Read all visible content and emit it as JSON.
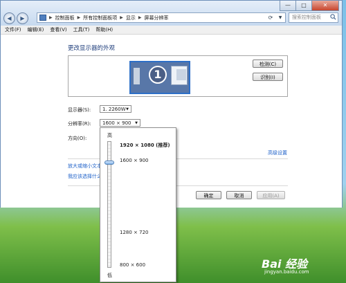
{
  "window": {
    "controls": {
      "minimize": "—",
      "maximize": "□",
      "close": "✕"
    },
    "breadcrumb": [
      "控制面板",
      "所有控制面板项",
      "显示",
      "屏幕分辨率"
    ],
    "search_placeholder": "搜索控制面板"
  },
  "menu": [
    "文件(F)",
    "编辑(E)",
    "查看(V)",
    "工具(T)",
    "帮助(H)"
  ],
  "main": {
    "title": "更改显示器的外观",
    "monitor_number": "1",
    "detect_button": "检测(C)",
    "identify_button": "识别(I)",
    "display_label": "显示器(S):",
    "display_value": "1. 2260W",
    "resolution_label": "分辨率(R):",
    "resolution_value": "1600 × 900",
    "orientation_label": "方向(O):",
    "advanced_link": "高级设置",
    "link1": "放大或缩小文本",
    "link2": "我应该选择什么",
    "ok_button": "确定",
    "cancel_button": "取消",
    "apply_button": "应用(A)"
  },
  "dropdown": {
    "high_label": "高",
    "low_label": "低",
    "slider_level_percent": 16,
    "options": [
      {
        "label": "1920 × 1080 (推荐)",
        "bold": true
      },
      {
        "label": "1600 × 900",
        "bold": false
      },
      {
        "label": "1280 × 720",
        "bold": false
      },
      {
        "label": "800 × 600",
        "bold": false
      }
    ]
  },
  "watermark": {
    "logo": "Bai 经验",
    "url": "jingyan.baidu.com"
  }
}
